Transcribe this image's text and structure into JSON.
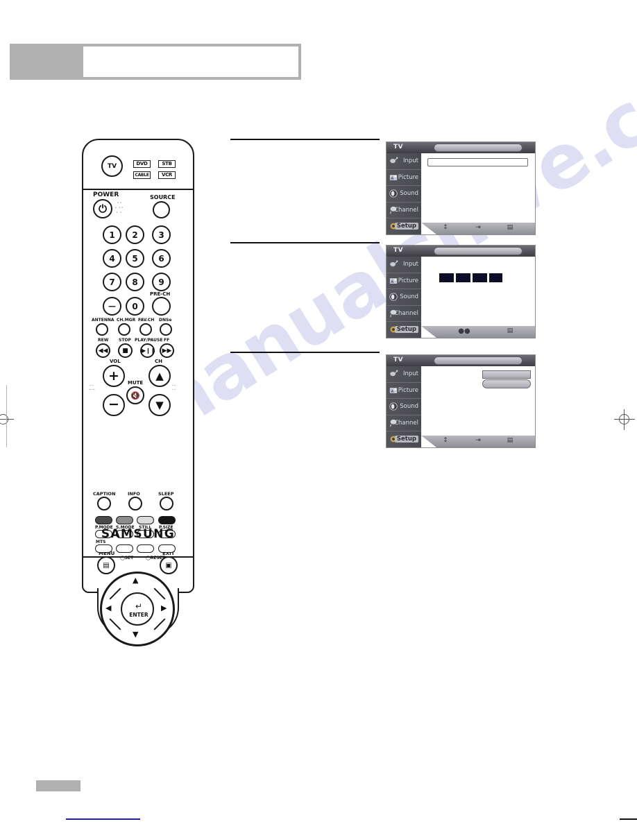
{
  "page": {
    "footer_page_number": "",
    "header_title": "",
    "watermark": "manualshive.com"
  },
  "remote": {
    "brand": "SAMSUNG",
    "device_buttons": [
      {
        "label": "TV",
        "type": "round"
      },
      {
        "label": "DVD",
        "type": "rect"
      },
      {
        "label": "STB",
        "type": "rect"
      },
      {
        "label": "CABLE",
        "type": "rect"
      },
      {
        "label": "VCR",
        "type": "rect"
      }
    ],
    "power_label": "POWER",
    "source_label": "SOURCE",
    "number_keys": [
      "1",
      "2",
      "3",
      "4",
      "5",
      "6",
      "7",
      "8",
      "9",
      "—",
      "0"
    ],
    "pre_ch_label": "PRE-CH",
    "function_row": [
      "ANTENNA",
      "CH.MGR",
      "FAV.CH",
      "DNSe"
    ],
    "transport_row": [
      "REW",
      "STOP",
      "PLAY/PAUSE",
      "FF"
    ],
    "vol_label": "VOL",
    "ch_label": "CH",
    "mute_label": "MUTE",
    "menu_label": "MENU",
    "exit_label": "EXIT",
    "enter_label": "ENTER",
    "bottom_row": [
      "CAPTION",
      "INFO",
      "SLEEP"
    ],
    "color_buttons": [
      {
        "label": "P.MODE",
        "color": "#4a4a4a"
      },
      {
        "label": "S.MODE",
        "color": "#8d8d8d"
      },
      {
        "label": "STILL",
        "color": "#dcdcdc"
      },
      {
        "label": "P.SIZE",
        "color": "#151515"
      }
    ],
    "mts_label": "MTS",
    "set_label": "SET",
    "reset_label": "RESET"
  },
  "tv_menus": [
    {
      "topbar_label": "TV",
      "title": "",
      "sidebar": [
        {
          "label": "Input",
          "icon": "input-icon",
          "active": false
        },
        {
          "label": "Picture",
          "icon": "picture-icon",
          "active": false
        },
        {
          "label": "Sound",
          "icon": "sound-icon",
          "active": false
        },
        {
          "label": "Channel",
          "icon": "channel-icon",
          "active": false
        },
        {
          "label": "Setup",
          "icon": "setup-icon",
          "active": true
        }
      ],
      "bottom_icons": [
        "updown-arrow-icon",
        "enter-icon",
        "menu-icon"
      ]
    },
    {
      "topbar_label": "TV",
      "title": "",
      "sidebar": [
        {
          "label": "Input",
          "icon": "input-icon",
          "active": false
        },
        {
          "label": "Picture",
          "icon": "picture-icon",
          "active": false
        },
        {
          "label": "Sound",
          "icon": "sound-icon",
          "active": false
        },
        {
          "label": "Channel",
          "icon": "channel-icon",
          "active": false
        },
        {
          "label": "Setup",
          "icon": "setup-icon",
          "active": true
        }
      ],
      "bottom_icons": [
        "leftright-arrow-icon",
        "menu-icon"
      ]
    },
    {
      "topbar_label": "TV",
      "title": "",
      "sidebar": [
        {
          "label": "Input",
          "icon": "input-icon",
          "active": false
        },
        {
          "label": "Picture",
          "icon": "picture-icon",
          "active": false
        },
        {
          "label": "Sound",
          "icon": "sound-icon",
          "active": false
        },
        {
          "label": "Channel",
          "icon": "channel-icon",
          "active": false
        },
        {
          "label": "Setup",
          "icon": "setup-icon",
          "active": true
        }
      ],
      "bottom_icons": [
        "updown-arrow-icon",
        "enter-icon",
        "menu-icon"
      ]
    }
  ]
}
